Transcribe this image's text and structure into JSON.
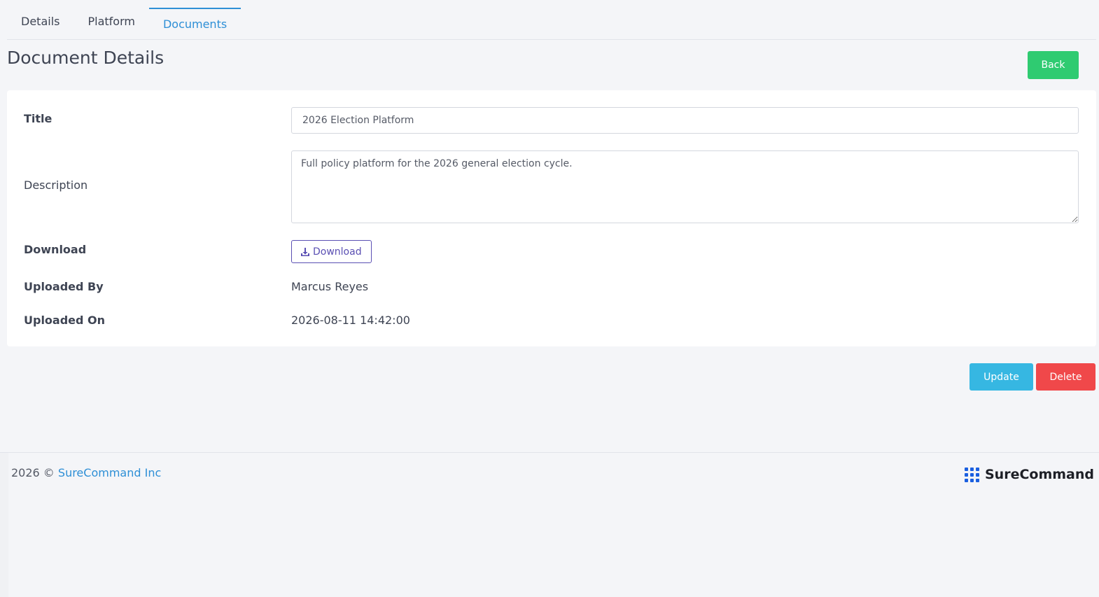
{
  "tabs": [
    {
      "label": "Details"
    },
    {
      "label": "Platform"
    },
    {
      "label": "Documents"
    }
  ],
  "page_title": "Document Details",
  "back_label": "Back",
  "form": {
    "title_label": "Title",
    "title_value": "2026 Election Platform",
    "description_label": "Description",
    "description_value": "Full policy platform for the 2026 general election cycle.",
    "download_label": "Download",
    "download_button": "Download",
    "uploaded_by_label": "Uploaded By",
    "uploaded_by_value": "Marcus Reyes",
    "uploaded_on_label": "Uploaded On",
    "uploaded_on_value": "2026-08-11 14:42:00"
  },
  "actions": {
    "update_label": "Update",
    "delete_label": "Delete"
  },
  "footer": {
    "copyright": "2026 ©",
    "company_link": "SureCommand Inc",
    "logo_text": "SureCommand"
  },
  "colors": {
    "accent": "#2e8fd6",
    "back": "#2fcb71",
    "update": "#36b7e2",
    "delete": "#f0484a",
    "download": "#5a4fb3"
  }
}
